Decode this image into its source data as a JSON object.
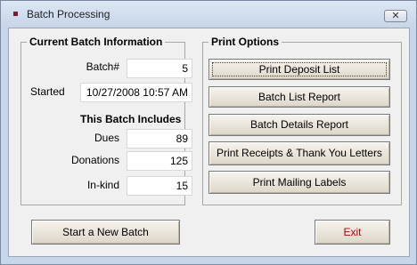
{
  "window": {
    "title": "Batch Processing",
    "close_glyph": "✕"
  },
  "batch_info": {
    "heading": "Current Batch Information",
    "batch_label": "Batch#",
    "batch_value": "5",
    "started_label": "Started",
    "started_value": "10/27/2008 10:57 AM",
    "includes_heading": "This Batch Includes",
    "dues_label": "Dues",
    "dues_value": "89",
    "donations_label": "Donations",
    "donations_value": "125",
    "inkind_label": "In-kind",
    "inkind_value": "15"
  },
  "print_options": {
    "heading": "Print Options",
    "buttons": [
      "Print Deposit List",
      "Batch List Report",
      "Batch Details Report",
      "Print Receipts & Thank You Letters",
      "Print Mailing Labels"
    ]
  },
  "footer": {
    "new_batch_label": "Start a New Batch",
    "exit_label": "Exit"
  },
  "colors": {
    "exit_text": "#c00000",
    "title_icon": "#8a1430"
  }
}
